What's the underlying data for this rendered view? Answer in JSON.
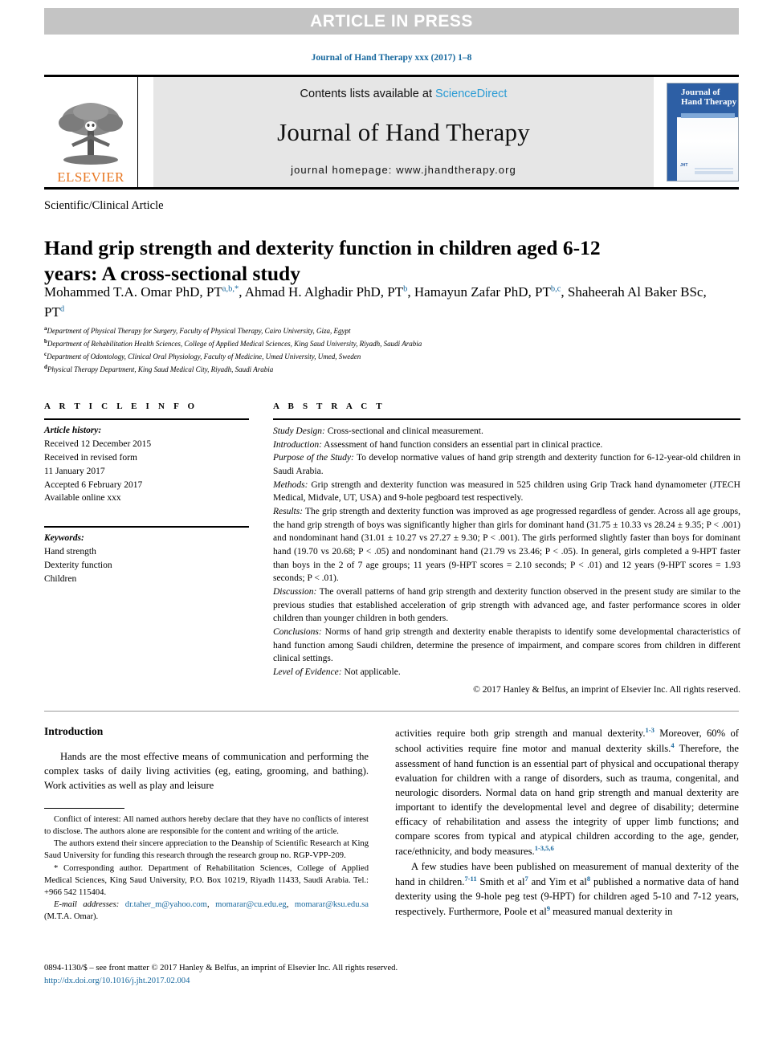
{
  "banner": {
    "text": "ARTICLE IN PRESS"
  },
  "journal_ref": "Journal of Hand Therapy xxx (2017) 1–8",
  "masthead": {
    "publisher_name": "ELSEVIER",
    "contents_prefix": "Contents lists available at ",
    "contents_link": "ScienceDirect",
    "journal_name": "Journal of Hand Therapy",
    "homepage": "journal homepage: www.jhandtherapy.org",
    "cover_title_line1": "Journal of",
    "cover_title_line2": "Hand Therapy",
    "cover_footer_mark": "JHT"
  },
  "article_type": "Scientific/Clinical Article",
  "title": "Hand grip strength and dexterity function in children aged 6-12 years: A cross-sectional study",
  "authors": {
    "a1_name": "Mohammed T.A. Omar PhD, PT",
    "a1_sup": "a,b,*",
    "a2_name": ", Ahmad H. Alghadir PhD, PT",
    "a2_sup": "b",
    "a3_name": ", Hamayun Zafar PhD, PT",
    "a3_sup": "b,c",
    "a4_name": ", Shaheerah Al Baker BSc, PT",
    "a4_sup": "d"
  },
  "affiliations": [
    {
      "mark": "a",
      "text": "Department of Physical Therapy for Surgery, Faculty of Physical Therapy, Cairo University, Giza, Egypt"
    },
    {
      "mark": "b",
      "text": "Department of Rehabilitation Health Sciences, College of Applied Medical Sciences, King Saud University, Riyadh, Saudi Arabia"
    },
    {
      "mark": "c",
      "text": "Department of Odontology, Clinical Oral Physiology, Faculty of Medicine, Umed University, Umed, Sweden"
    },
    {
      "mark": "d",
      "text": "Physical Therapy Department, King Saud Medical City, Riyadh, Saudi Arabia"
    }
  ],
  "article_info": {
    "heading": "A R T I C L E  I N F O",
    "history_label": "Article history:",
    "history_lines": [
      "Received 12 December 2015",
      "Received in revised form",
      "11 January 2017",
      "Accepted 6 February 2017",
      "Available online xxx"
    ],
    "keywords_label": "Keywords:",
    "keywords": [
      "Hand strength",
      "Dexterity function",
      "Children"
    ]
  },
  "abstract": {
    "heading": "A B S T R A C T",
    "sections": [
      {
        "label": "Study Design:",
        "text": " Cross-sectional and clinical measurement."
      },
      {
        "label": "Introduction:",
        "text": " Assessment of hand function considers an essential part in clinical practice."
      },
      {
        "label": "Purpose of the Study:",
        "text": " To develop normative values of hand grip strength and dexterity function for 6-12-year-old children in Saudi Arabia."
      },
      {
        "label": "Methods:",
        "text": " Grip strength and dexterity function was measured in 525 children using Grip Track hand dynamometer (JTECH Medical, Midvale, UT, USA) and 9-hole pegboard test respectively."
      },
      {
        "label": "Results:",
        "text": " The grip strength and dexterity function was improved as age progressed regardless of gender. Across all age groups, the hand grip strength of boys was significantly higher than girls for dominant hand (31.75 ± 10.33 vs 28.24 ± 9.35; P < .001) and nondominant hand (31.01 ± 10.27 vs 27.27 ± 9.30; P < .001). The girls performed slightly faster than boys for dominant hand (19.70 vs 20.68; P < .05) and nondominant hand (21.79 vs 23.46; P < .05). In general, girls completed a 9-HPT faster than boys in the 2 of 7 age groups; 11 years (9-HPT scores = 2.10 seconds; P < .01) and 12 years (9-HPT scores = 1.93 seconds; P < .01)."
      },
      {
        "label": "Discussion:",
        "text": " The overall patterns of hand grip strength and dexterity function observed in the present study are similar to the previous studies that established acceleration of grip strength with advanced age, and faster performance scores in older children than younger children in both genders."
      },
      {
        "label": "Conclusions:",
        "text": " Norms of hand grip strength and dexterity enable therapists to identify some developmental characteristics of hand function among Saudi children, determine the presence of impairment, and compare scores from children in different clinical settings."
      },
      {
        "label": "Level of Evidence:",
        "text": " Not applicable."
      }
    ],
    "copyright": "© 2017 Hanley & Belfus, an imprint of Elsevier Inc. All rights reserved."
  },
  "body": {
    "intro_heading": "Introduction",
    "left_paragraph": "Hands are the most effective means of communication and performing the complex tasks of daily living activities (eg, eating, grooming, and bathing). Work activities as well as play and leisure",
    "right_p1_a": "activities require both grip strength and manual dexterity.",
    "right_p1_sup1": "1-3",
    "right_p1_b": " Moreover, 60% of school activities require fine motor and manual dexterity skills.",
    "right_p1_sup2": "4",
    "right_p1_c": " Therefore, the assessment of hand function is an essential part of physical and occupational therapy evaluation for children with a range of disorders, such as trauma, congenital, and neurologic disorders. Normal data on hand grip strength and manual dexterity are important to identify the developmental level and degree of disability; determine efficacy of rehabilitation and assess the integrity of upper limb functions; and compare scores from typical and atypical children according to the age, gender, race/ethnicity, and body measures.",
    "right_p1_sup3": "1-3,5,6",
    "right_p2_a": "A few studies have been published on measurement of manual dexterity of the hand in children.",
    "right_p2_sup1": "7-11",
    "right_p2_b": " Smith et al",
    "right_p2_sup2": "7",
    "right_p2_c": " and Yim et al",
    "right_p2_sup3": "8",
    "right_p2_d": " published a normative data of hand dexterity using the 9-hole peg test (9-HPT) for children aged 5-10 and 7-12 years, respectively. Furthermore, Poole et al",
    "right_p2_sup4": "9",
    "right_p2_e": " measured manual dexterity in"
  },
  "footnotes": {
    "p1": "Conflict of interest: All named authors hereby declare that they have no conflicts of interest to disclose. The authors alone are responsible for the content and writing of the article.",
    "p2": "The authors extend their sincere appreciation to the Deanship of Scientific Research at King Saud University for funding this research through the research group no. RGP-VPP-209.",
    "p3_star": "* Corresponding author. ",
    "p3": "Department of Rehabilitation Sciences, College of Applied Medical Sciences, King Saud University, P.O. Box 10219, Riyadh 11433, Saudi Arabia. Tel.: +966 542 115404.",
    "email_label": "E-mail addresses:",
    "email1": "dr.taher_m@yahoo.com",
    "email2": "momarar@cu.edu.eg",
    "email3": "momarar@ksu.edu.sa",
    "email_owner": " (M.T.A. Omar)."
  },
  "footer": {
    "issn_line": "0894-1130/$ – see front matter © 2017 Hanley & Belfus, an imprint of Elsevier Inc. All rights reserved.",
    "doi": "http://dx.doi.org/10.1016/j.jht.2017.02.004"
  },
  "colors": {
    "link_blue": "#17689e",
    "sciencedirect_blue": "#2a9bd4",
    "elsevier_orange": "#e87722",
    "banner_gray": "#c4c4c4",
    "masthead_gray": "#e6e6e6",
    "cover_blue": "#2d5fa5"
  }
}
